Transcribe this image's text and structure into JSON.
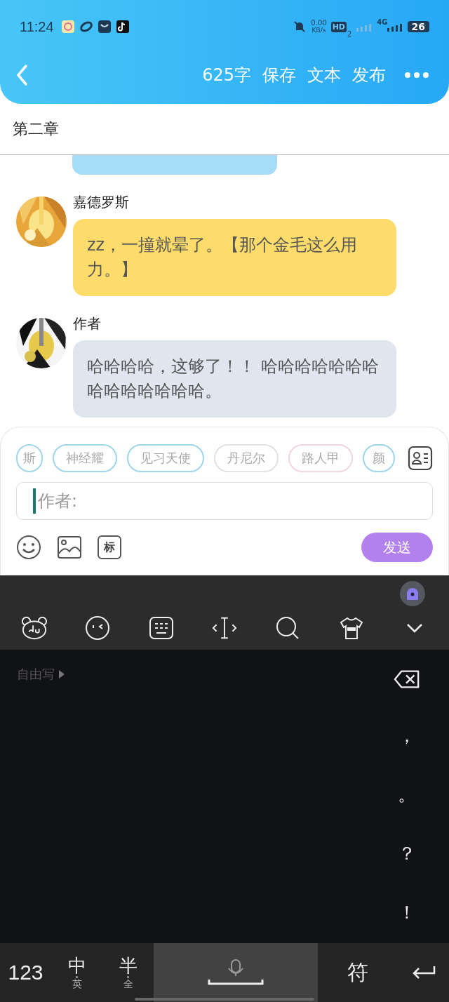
{
  "status_bar": {
    "time": "11:24",
    "net_speed": "0.00",
    "net_unit": "KB/s",
    "hd": "HD",
    "hd_sub": "2",
    "network": "4G",
    "battery": "26"
  },
  "header": {
    "word_count": "625字",
    "actions": [
      "保存",
      "文本",
      "发布"
    ]
  },
  "chapter_title": "第二章",
  "messages": [
    {
      "kind": "cut",
      "color": "#a6dcf7"
    },
    {
      "kind": "message",
      "name": "嘉德罗斯",
      "text": "zz，一撞就晕了。【那个金毛这么用力。】",
      "color": "#fddc6c"
    },
    {
      "kind": "message",
      "name": "作者",
      "text": "哈哈哈哈，这够了！！ 哈哈哈哈哈哈哈哈哈哈哈哈哈哈。",
      "color": "#e0e5ef"
    }
  ],
  "role_tags": [
    {
      "label": "斯",
      "color": "#9fd6ea"
    },
    {
      "label": "神经耀",
      "color": "#9fd6ea"
    },
    {
      "label": "见习天使",
      "color": "#9fd6ea"
    },
    {
      "label": "丹尼尔",
      "color": "#e2e2e2"
    },
    {
      "label": "路人甲",
      "color": "#f3d6dc"
    },
    {
      "label": "颜",
      "color": "#9fd6ea"
    }
  ],
  "input": {
    "placeholder": "作者:"
  },
  "mark_button": "标",
  "send_button": "发送",
  "keyboard": {
    "free_write": "自由写",
    "punctuation": [
      "，",
      "。",
      "？",
      "！"
    ],
    "bottom": [
      {
        "kind": "key",
        "label": "123"
      },
      {
        "kind": "dual",
        "label": "中",
        "sub": "英"
      },
      {
        "kind": "dual",
        "label": "半",
        "sub": "全"
      },
      {
        "kind": "space"
      },
      {
        "kind": "key",
        "label": "符"
      },
      {
        "kind": "enter"
      }
    ]
  }
}
